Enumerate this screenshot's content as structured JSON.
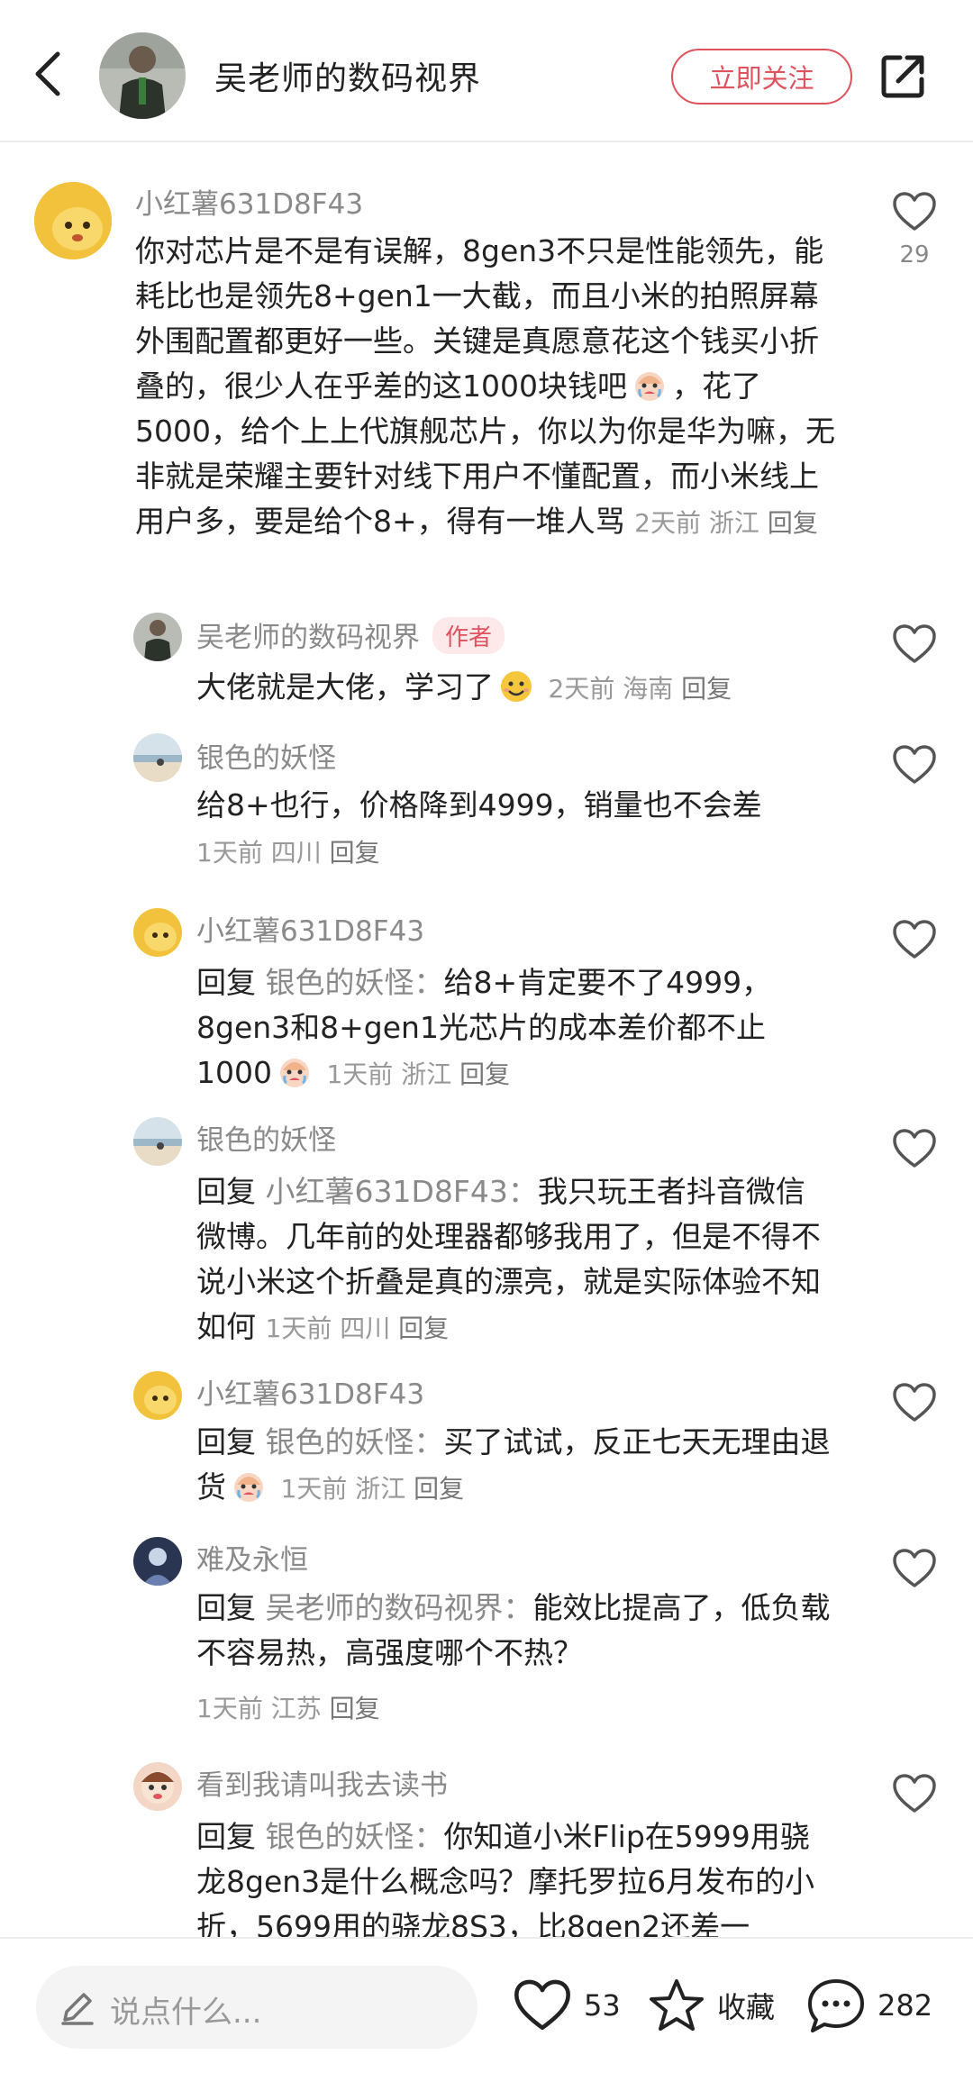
{
  "header": {
    "title": "吴老师的数码视界",
    "follow_label": "立即关注"
  },
  "comments": [
    {
      "name": "小红薯631D8F43",
      "text_a": "你对芯片是不是有误解，8gen3不只是性能领先，能耗比也是领先8+gen1一大截，而且小米的拍照屏幕外围配置都更好一些。关键是真愿意花这个钱买小折叠的，很少人在乎差的这1000块钱吧",
      "text_b": "，花了5000，给个上上代旗舰芯片，你以为你是华为嘛，无非就是荣耀主要针对线下用户不懂配置，而小米线上用户多，要是给个8+，得有一堆人骂",
      "time": "2天前",
      "location": "浙江",
      "reply": "回复",
      "likes": "29"
    },
    {
      "name": "吴老师的数码视界",
      "badge": "作者",
      "text_a": "大佬就是大佬，学习了",
      "time": "2天前",
      "location": "海南",
      "reply": "回复"
    },
    {
      "name": "银色的妖怪",
      "text_a": "给8+也行，价格降到4999，销量也不会差",
      "time": "1天前",
      "location": "四川",
      "reply": "回复"
    },
    {
      "name": "小红薯631D8F43",
      "prefix": "回复",
      "mention": "银色的妖怪：",
      "text_a": "给8+肯定要不了4999，8gen3和8+gen1光芯片的成本差价都不止1000",
      "time": "1天前",
      "location": "浙江",
      "reply": "回复"
    },
    {
      "name": "银色的妖怪",
      "prefix": "回复",
      "mention": "小红薯631D8F43：",
      "text_a": "我只玩王者抖音微信微博。几年前的处理器都够我用了，但是不得不说小米这个折叠是真的漂亮，就是实际体验不知如何",
      "time": "1天前",
      "location": "四川",
      "reply": "回复"
    },
    {
      "name": "小红薯631D8F43",
      "prefix": "回复",
      "mention": "银色的妖怪：",
      "text_a": "买了试试，反正七天无理由退货",
      "time": "1天前",
      "location": "浙江",
      "reply": "回复"
    },
    {
      "name": "难及永恒",
      "prefix": "回复",
      "mention": "吴老师的数码视界：",
      "text_a": "能效比提高了，低负载不容易热，高强度哪个不热？",
      "time": "1天前",
      "location": "江苏",
      "reply": "回复"
    },
    {
      "name": "看到我请叫我去读书",
      "prefix": "回复",
      "mention": "银色的妖怪：",
      "text_a": "你知道小米Flip在5999用骁龙8gen3是什么概念吗？摩托罗拉6月发布的小折，5699用的骁龙8S3，比8gen2还差一"
    }
  ],
  "bottom_bar": {
    "input_placeholder": "说点什么...",
    "likes": "53",
    "collect_label": "收藏",
    "comments": "282"
  },
  "colors": {
    "accent": "#e0525d",
    "secondary_text": "#8a8a8a"
  },
  "icons": [
    "back-arrow-icon",
    "share-icon",
    "heart-icon",
    "star-icon",
    "chat-bubble-icon",
    "pencil-icon",
    "crying-emoji-icon",
    "smile-emoji-icon"
  ]
}
